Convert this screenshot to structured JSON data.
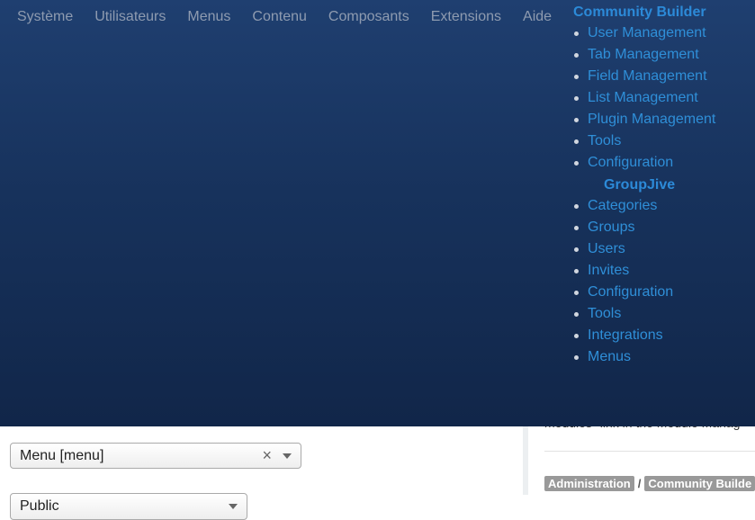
{
  "nav": {
    "items": [
      "Système",
      "Utilisateurs",
      "Menus",
      "Contenu",
      "Composants",
      "Extensions",
      "Aide"
    ]
  },
  "dropdown": {
    "community_builder": {
      "title": "Community Builder",
      "items": [
        "User Management",
        "Tab Management",
        "Field Management",
        "List Management",
        "Plugin Management",
        "Tools",
        "Configuration"
      ]
    },
    "groupjive": {
      "title": "GroupJive",
      "items": [
        "Categories",
        "Groups",
        "Users",
        "Invites",
        "Configuration",
        "Tools",
        "Integrations",
        "Menus"
      ]
    }
  },
  "form": {
    "menu_select": {
      "value": "Menu [menu]",
      "clear": "×"
    },
    "access_select": {
      "value": "Public"
    }
  },
  "side": {
    "peek_text": "modules\" link in the Module Manag",
    "breadcrumb": [
      "Administration",
      "Community Builde"
    ],
    "breadcrumb_sep": "/"
  }
}
